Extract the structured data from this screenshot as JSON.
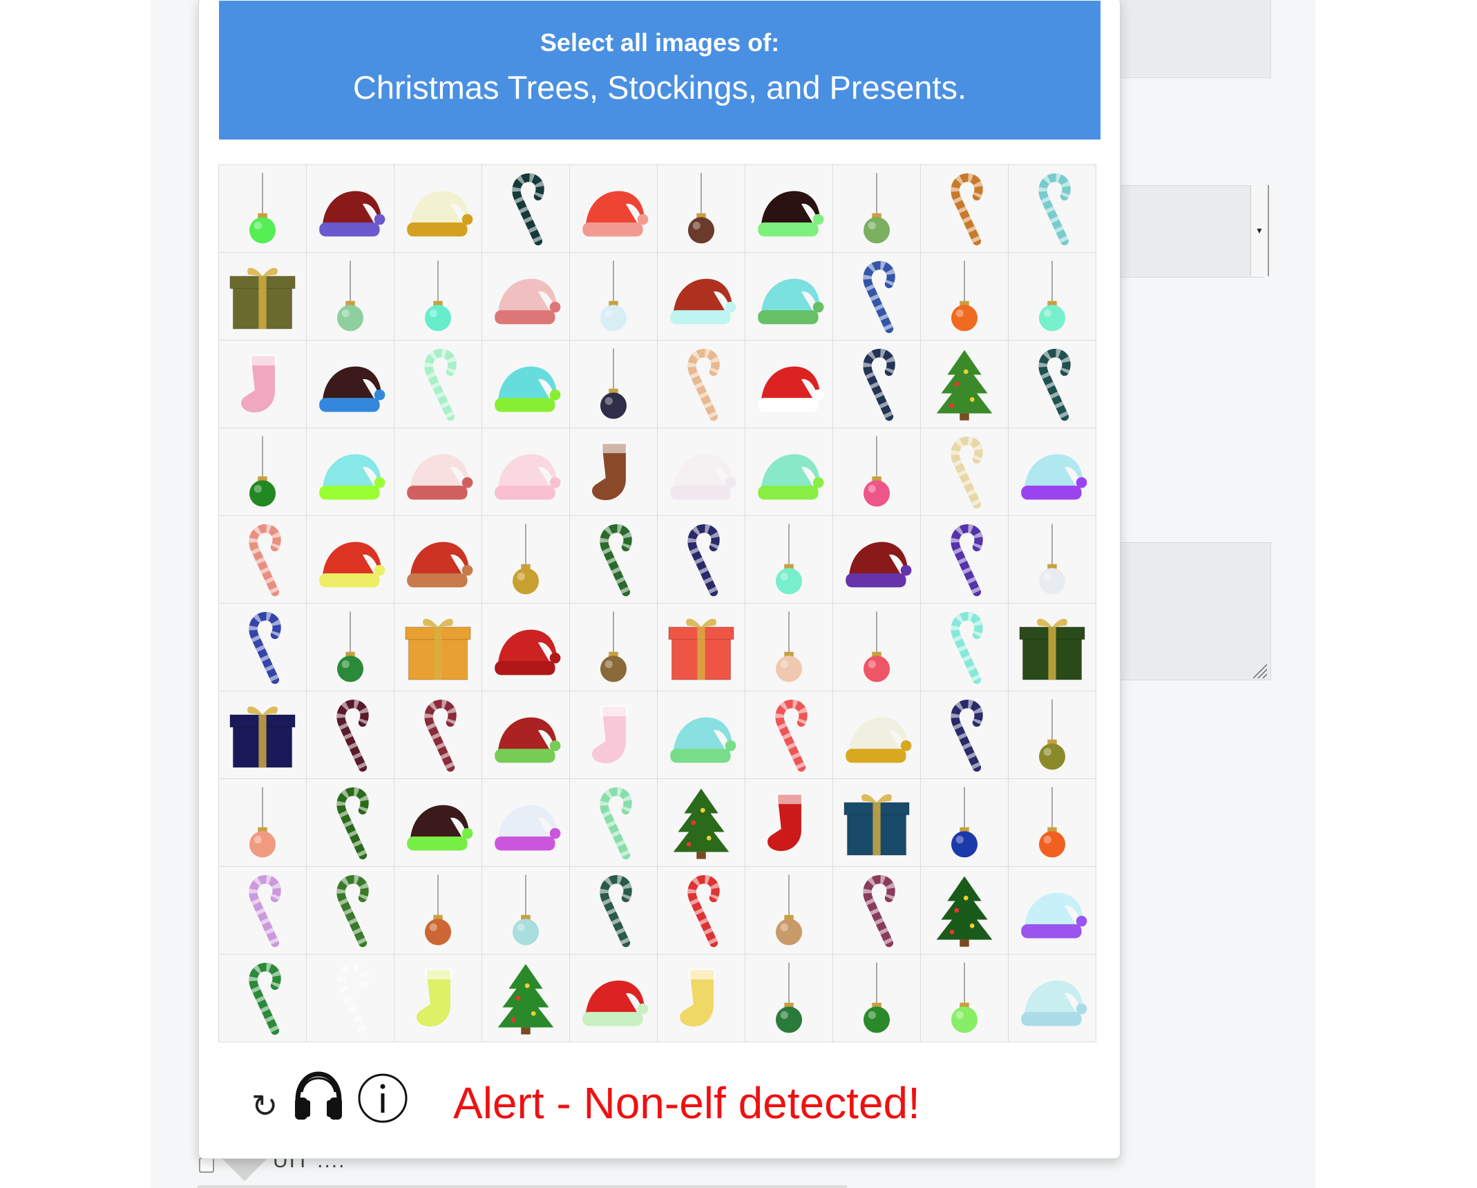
{
  "header": {
    "instruction": "Select all images of:",
    "targets": "Christmas Trees, Stockings, and Presents."
  },
  "grid": {
    "rows": [
      [
        {
          "item": "ornament",
          "color": "#55ee55"
        },
        {
          "item": "hat",
          "color": "#8a1a1a",
          "trim": "#6a5acd"
        },
        {
          "item": "hat",
          "color": "#f2f2d0",
          "trim": "#d4a020"
        },
        {
          "item": "candy-cane",
          "color": "#143a3a"
        },
        {
          "item": "hat",
          "color": "#ee4433",
          "trim": "#f39a90"
        },
        {
          "item": "ornament",
          "color": "#6a3a2a"
        },
        {
          "item": "hat",
          "color": "#2a1212",
          "trim": "#7ef07e"
        },
        {
          "item": "ornament",
          "color": "#7ab060"
        },
        {
          "item": "candy-cane",
          "color": "#c87a2a"
        },
        {
          "item": "candy-cane",
          "color": "#77cccc"
        }
      ],
      [
        {
          "item": "present",
          "color": "#6b6a2e"
        },
        {
          "item": "ornament",
          "color": "#8fcf9f"
        },
        {
          "item": "ornament",
          "color": "#66eecc"
        },
        {
          "item": "hat",
          "color": "#f0c0c0",
          "trim": "#dd7777"
        },
        {
          "item": "ornament",
          "color": "#d8eef5"
        },
        {
          "item": "hat",
          "color": "#b03020",
          "trim": "#bff5f0"
        },
        {
          "item": "hat",
          "color": "#7ae0e0",
          "trim": "#66c066"
        },
        {
          "item": "candy-cane",
          "color": "#3355aa"
        },
        {
          "item": "ornament",
          "color": "#f06a20"
        },
        {
          "item": "ornament",
          "color": "#77f0cc"
        }
      ],
      [
        {
          "item": "stocking",
          "color": "#f0a8c0"
        },
        {
          "item": "hat",
          "color": "#3a1a1a",
          "trim": "#3388dd"
        },
        {
          "item": "candy-cane",
          "color": "#a8f0c8"
        },
        {
          "item": "hat",
          "color": "#66dddd",
          "trim": "#88ee33"
        },
        {
          "item": "ornament",
          "color": "#2e2e48"
        },
        {
          "item": "candy-cane",
          "color": "#e8b890"
        },
        {
          "item": "hat",
          "color": "#dd2222",
          "trim": "#ffffff"
        },
        {
          "item": "candy-cane",
          "color": "#223355"
        },
        {
          "item": "tree",
          "color": "#3a8a2a"
        },
        {
          "item": "candy-cane",
          "color": "#1f5050"
        }
      ],
      [
        {
          "item": "ornament",
          "color": "#228822"
        },
        {
          "item": "hat",
          "color": "#88e8e8",
          "trim": "#99ff33"
        },
        {
          "item": "hat",
          "color": "#f8e0e0",
          "trim": "#d06060"
        },
        {
          "item": "hat",
          "color": "#fad8e0",
          "trim": "#f8c0d0"
        },
        {
          "item": "stocking",
          "color": "#8a4a2a"
        },
        {
          "item": "hat",
          "color": "#f5f0f2",
          "trim": "#f0e8ee"
        },
        {
          "item": "hat",
          "color": "#88e8c8",
          "trim": "#88ee44"
        },
        {
          "item": "ornament",
          "color": "#ee5588"
        },
        {
          "item": "candy-cane",
          "color": "#e8d8a8"
        },
        {
          "item": "hat",
          "color": "#b0e8f0",
          "trim": "#9944ee"
        }
      ],
      [
        {
          "item": "candy-cane",
          "color": "#e89080"
        },
        {
          "item": "hat",
          "color": "#dd3322",
          "trim": "#eeee66"
        },
        {
          "item": "hat",
          "color": "#cc3322",
          "trim": "#c87a4a"
        },
        {
          "item": "ornament",
          "color": "#c8a030"
        },
        {
          "item": "candy-cane",
          "color": "#2a6a2a"
        },
        {
          "item": "candy-cane",
          "color": "#2a2a6a"
        },
        {
          "item": "ornament",
          "color": "#77eecc"
        },
        {
          "item": "hat",
          "color": "#8a1a1a",
          "trim": "#6633aa"
        },
        {
          "item": "candy-cane",
          "color": "#5533aa"
        },
        {
          "item": "ornament",
          "color": "#e8ecf0"
        }
      ],
      [
        {
          "item": "candy-cane",
          "color": "#3344aa"
        },
        {
          "item": "ornament",
          "color": "#2a8a3a"
        },
        {
          "item": "present",
          "color": "#e8a030"
        },
        {
          "item": "hat",
          "color": "#cc2222",
          "trim": "#b01818"
        },
        {
          "item": "ornament",
          "color": "#8a6a3a"
        },
        {
          "item": "present",
          "color": "#ee5544"
        },
        {
          "item": "ornament",
          "color": "#f0c8b0"
        },
        {
          "item": "ornament",
          "color": "#ee5566"
        },
        {
          "item": "candy-cane",
          "color": "#88e8d8"
        },
        {
          "item": "present",
          "color": "#2a4a1a"
        }
      ],
      [
        {
          "item": "present",
          "color": "#1a1a5a"
        },
        {
          "item": "candy-cane",
          "color": "#5a1a2a"
        },
        {
          "item": "candy-cane",
          "color": "#8a2a3a"
        },
        {
          "item": "hat",
          "color": "#aa2222",
          "trim": "#77cc55"
        },
        {
          "item": "stocking",
          "color": "#f8c8d8"
        },
        {
          "item": "hat",
          "color": "#88e0e0",
          "trim": "#77dd88"
        },
        {
          "item": "candy-cane",
          "color": "#ee5555"
        },
        {
          "item": "hat",
          "color": "#f0f0e0",
          "trim": "#d8a820"
        },
        {
          "item": "candy-cane",
          "color": "#2a2a6a"
        },
        {
          "item": "ornament",
          "color": "#8a8a2a"
        }
      ],
      [
        {
          "item": "ornament",
          "color": "#f09a80"
        },
        {
          "item": "candy-cane",
          "color": "#2a6a1a"
        },
        {
          "item": "hat",
          "color": "#3a1a1a",
          "trim": "#77ee44"
        },
        {
          "item": "hat",
          "color": "#e8eef8",
          "trim": "#cc55dd"
        },
        {
          "item": "candy-cane",
          "color": "#88ddaa"
        },
        {
          "item": "tree",
          "color": "#2a6a1a"
        },
        {
          "item": "stocking",
          "color": "#cc1a1a"
        },
        {
          "item": "present",
          "color": "#1a4a6a"
        },
        {
          "item": "ornament",
          "color": "#1a3aaa"
        },
        {
          "item": "ornament",
          "color": "#f06020"
        }
      ],
      [
        {
          "item": "candy-cane",
          "color": "#cc99dd"
        },
        {
          "item": "candy-cane",
          "color": "#3a7a2a"
        },
        {
          "item": "ornament",
          "color": "#cc6633"
        },
        {
          "item": "ornament",
          "color": "#aadddd"
        },
        {
          "item": "candy-cane",
          "color": "#2a5a4a"
        },
        {
          "item": "candy-cane",
          "color": "#dd3333"
        },
        {
          "item": "ornament",
          "color": "#c89a6a"
        },
        {
          "item": "candy-cane",
          "color": "#8a3a5a"
        },
        {
          "item": "tree",
          "color": "#1a5a1a"
        },
        {
          "item": "hat",
          "color": "#c8f0f8",
          "trim": "#9955ee"
        }
      ],
      [
        {
          "item": "candy-cane",
          "color": "#2a8a3a"
        },
        {
          "item": "candy-cane",
          "color": "#f8f8f8"
        },
        {
          "item": "stocking",
          "color": "#ddf066"
        },
        {
          "item": "tree",
          "color": "#2a8a2a"
        },
        {
          "item": "hat",
          "color": "#dd2222",
          "trim": "#c8f0c0"
        },
        {
          "item": "stocking",
          "color": "#f0d866"
        },
        {
          "item": "ornament",
          "color": "#2a7a3a"
        },
        {
          "item": "ornament",
          "color": "#2a8a2a"
        },
        {
          "item": "ornament",
          "color": "#88ee66"
        },
        {
          "item": "hat",
          "color": "#c8eef0",
          "trim": "#aadde8"
        }
      ]
    ]
  },
  "footer": {
    "refresh_icon": "↻",
    "alert_text": "Alert - Non-elf detected!",
    "alert_color": "#ee1111"
  },
  "background": {
    "checkbox_label": "UIT ...."
  }
}
